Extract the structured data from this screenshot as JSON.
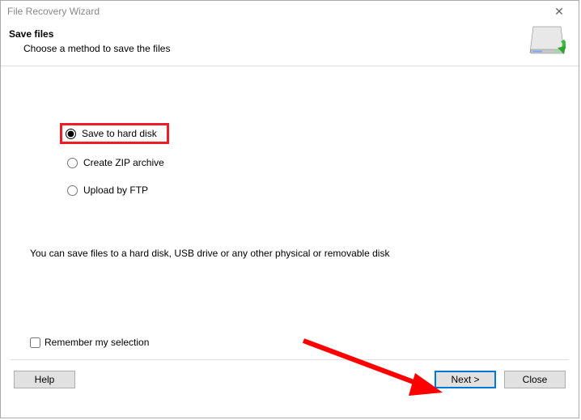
{
  "titlebar": {
    "title": "File Recovery Wizard"
  },
  "header": {
    "title": "Save files",
    "subtitle": "Choose a method to save the files"
  },
  "options": {
    "save_disk": "Save to hard disk",
    "zip": "Create ZIP archive",
    "ftp": "Upload by FTP"
  },
  "description": "You can save files to a hard disk, USB drive or any other physical or removable disk",
  "remember_label": "Remember my selection",
  "buttons": {
    "help": "Help",
    "next": "Next >",
    "close": "Close"
  },
  "icons": {
    "close_x": "✕"
  }
}
